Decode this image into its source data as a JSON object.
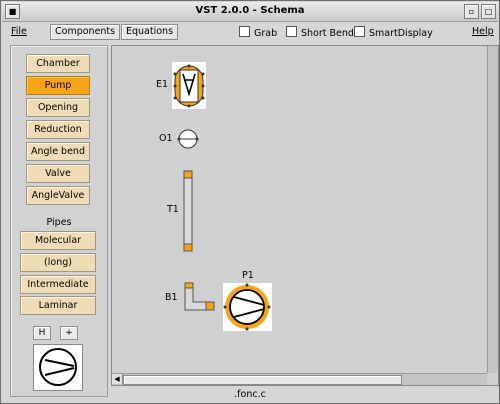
{
  "window": {
    "title": "VST 2.0.0 - Schema"
  },
  "menu": {
    "file": "File",
    "components": "Components",
    "equations": "Equations",
    "grab": "Grab",
    "short_bend": "Short Bend",
    "smart_display": "SmartDisplay",
    "help": "Help"
  },
  "palette": {
    "items": [
      "Chamber",
      "Pump",
      "Opening",
      "Reduction",
      "Angle bend",
      "Valve",
      "AngleValve"
    ],
    "active": "Pump",
    "pipes_label": "Pipes",
    "pipes": [
      "Molecular",
      "(long)",
      "Intermediate",
      "Laminar"
    ],
    "h_button": "H",
    "plus_button": "+",
    "preview_icon": "pump-icon"
  },
  "canvas": {
    "components": [
      {
        "label": "E1",
        "icon": "chamber-icon"
      },
      {
        "label": "O1",
        "icon": "opening-icon"
      },
      {
        "label": "T1",
        "icon": "tube-icon"
      },
      {
        "label": "B1",
        "icon": "angle-bend-icon"
      },
      {
        "label": "P1",
        "icon": "pump-icon"
      }
    ]
  },
  "colors": {
    "accent": "#f7a417",
    "button_fill": "#f0dcb4"
  },
  "status": {
    "file": ".fonc.c"
  }
}
